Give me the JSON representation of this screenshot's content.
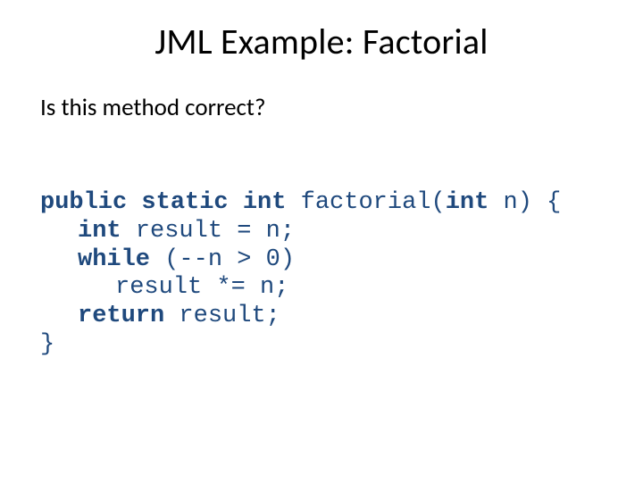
{
  "title": "JML Example: Factorial",
  "subtitle": "Is this method correct?",
  "code": {
    "kw_public": "public",
    "kw_static": "static",
    "kw_int1": "int",
    "fn": " factorial(",
    "kw_int2": "int",
    "param_close": " n) {",
    "kw_int3": "int",
    "l2_rest": " result = n;",
    "kw_while": "while",
    "l3_rest": " (--n > 0)",
    "l4": "result *= n;",
    "kw_return": "return",
    "l5_rest": " result;",
    "l6": "}"
  }
}
